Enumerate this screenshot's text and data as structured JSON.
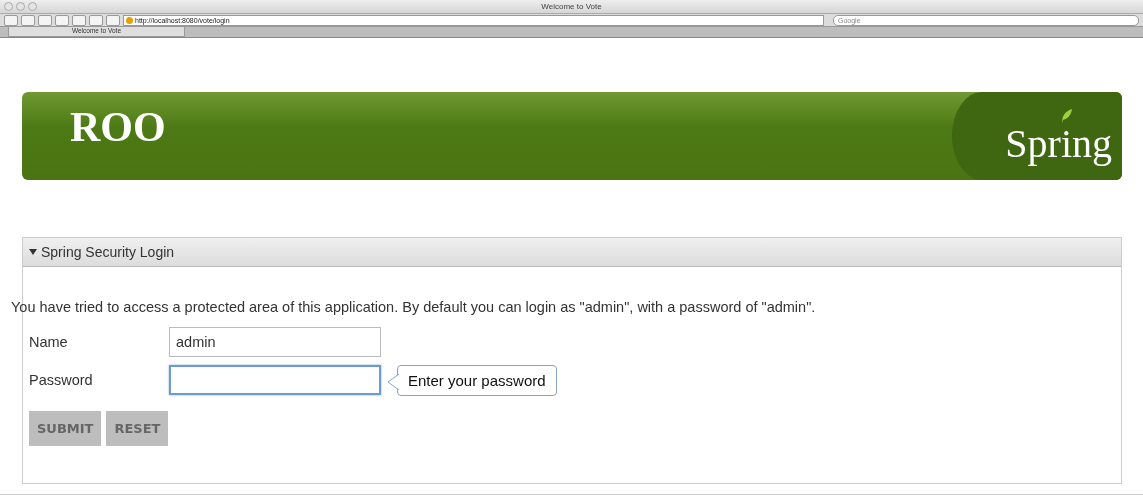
{
  "window": {
    "title": "Welcome to Vote"
  },
  "toolbar": {
    "url": "http://localhost:8080/vote/login",
    "search": {
      "placeholder": "Google"
    }
  },
  "tabs": [
    {
      "label": "Welcome to Vote",
      "selected": true
    }
  ],
  "banner": {
    "left_logo": "ROO",
    "right_logo": "Spring"
  },
  "panel": {
    "title": "Spring Security Login",
    "expanded": true,
    "message": "You have tried to access a protected area of this application. By default you can login as \"admin\", with a password of \"admin\".",
    "fields": [
      {
        "label": "Name",
        "value": "admin",
        "focused": false
      },
      {
        "label": "Password",
        "focused": true,
        "tooltip": "Enter your password"
      }
    ],
    "buttons": [
      "SUBMIT",
      "RESET"
    ]
  }
}
